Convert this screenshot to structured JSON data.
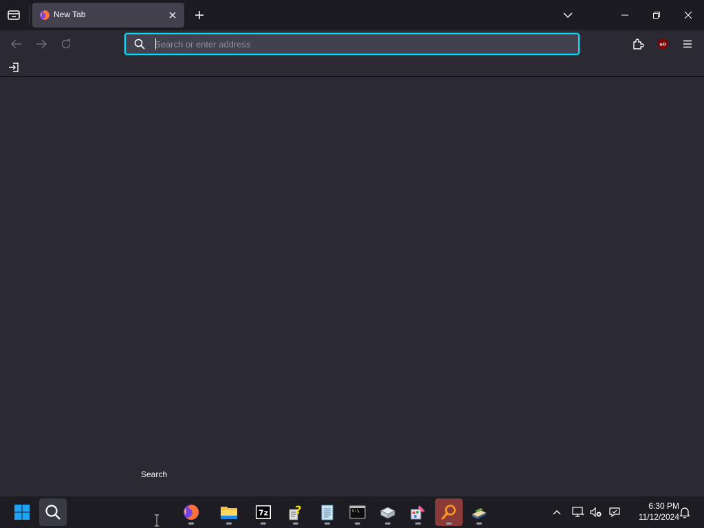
{
  "browser": {
    "tab": {
      "title": "New Tab"
    },
    "urlbar": {
      "placeholder": "Search or enter address",
      "value": ""
    }
  },
  "tooltip": {
    "text": "Search"
  },
  "taskbar": {
    "apps": [
      {
        "name": "windows-start-icon"
      },
      {
        "name": "search-icon"
      },
      {
        "name": "firefox-icon"
      },
      {
        "name": "file-explorer-icon"
      },
      {
        "name": "7zip-icon"
      },
      {
        "name": "help-icon"
      },
      {
        "name": "notepad-icon"
      },
      {
        "name": "terminal-icon"
      },
      {
        "name": "app-icon"
      },
      {
        "name": "paint-icon"
      },
      {
        "name": "search-app-icon"
      },
      {
        "name": "books-icon"
      }
    ],
    "clock": {
      "time": "6:30 PM",
      "date": "11/12/2024"
    }
  },
  "colors": {
    "accent": "#00ddff",
    "tab_bg": "#42414d",
    "content_bg": "#2b2a33",
    "highlight": "#8b3a3a"
  }
}
